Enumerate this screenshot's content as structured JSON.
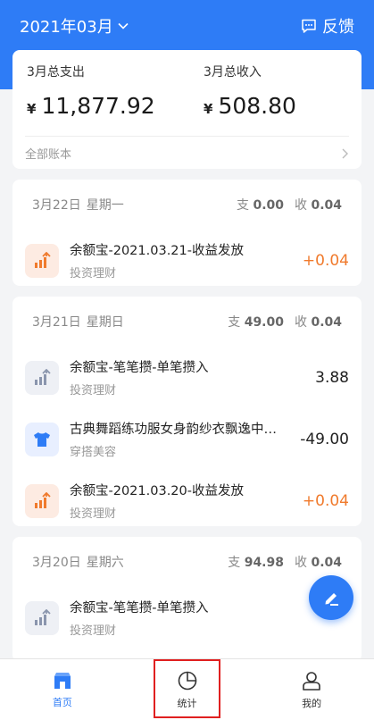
{
  "header": {
    "month": "2021年03月",
    "feedback_label": "反馈"
  },
  "summary": {
    "expense_label": "3月总支出",
    "expense_currency": "¥",
    "expense_amount": "11,877.92",
    "income_label": "3月总收入",
    "income_currency": "¥",
    "income_amount": "508.80",
    "all_accounts_label": "全部账本"
  },
  "days": [
    {
      "date": "3月22日",
      "weekday": "星期一",
      "expense_label": "支",
      "expense_total": "0.00",
      "income_label": "收",
      "income_total": "0.04",
      "transactions": [
        {
          "title": "余额宝-2021.03.21-收益发放",
          "category": "投资理财",
          "amount": "+0.04",
          "icon": "chart-up-icon"
        }
      ]
    },
    {
      "date": "3月21日",
      "weekday": "星期日",
      "expense_label": "支",
      "expense_total": "49.00",
      "income_label": "收",
      "income_total": "0.04",
      "transactions": [
        {
          "title": "余额宝-笔笔攒-单笔攒入",
          "category": "投资理财",
          "amount": "3.88",
          "icon": "chart-up-icon"
        },
        {
          "title": "古典舞蹈练功服女身韵纱衣飘逸中国风上衣",
          "category": "穿搭美容",
          "amount": "-49.00",
          "icon": "shirt-icon"
        },
        {
          "title": "余额宝-2021.03.20-收益发放",
          "category": "投资理财",
          "amount": "+0.04",
          "icon": "chart-up-icon"
        }
      ]
    },
    {
      "date": "3月20日",
      "weekday": "星期六",
      "expense_label": "支",
      "expense_total": "94.98",
      "income_label": "收",
      "income_total": "0.04",
      "transactions": [
        {
          "title": "余额宝-笔笔攒-单笔攒入",
          "category": "投资理财",
          "amount": "",
          "icon": "chart-up-icon"
        }
      ]
    }
  ],
  "tabbar": {
    "home_label": "首页",
    "stats_label": "统计",
    "mine_label": "我的"
  },
  "colors": {
    "brand_blue": "#2e7cf6",
    "income_orange": "#f07a2c",
    "highlight_red": "#e02020"
  }
}
